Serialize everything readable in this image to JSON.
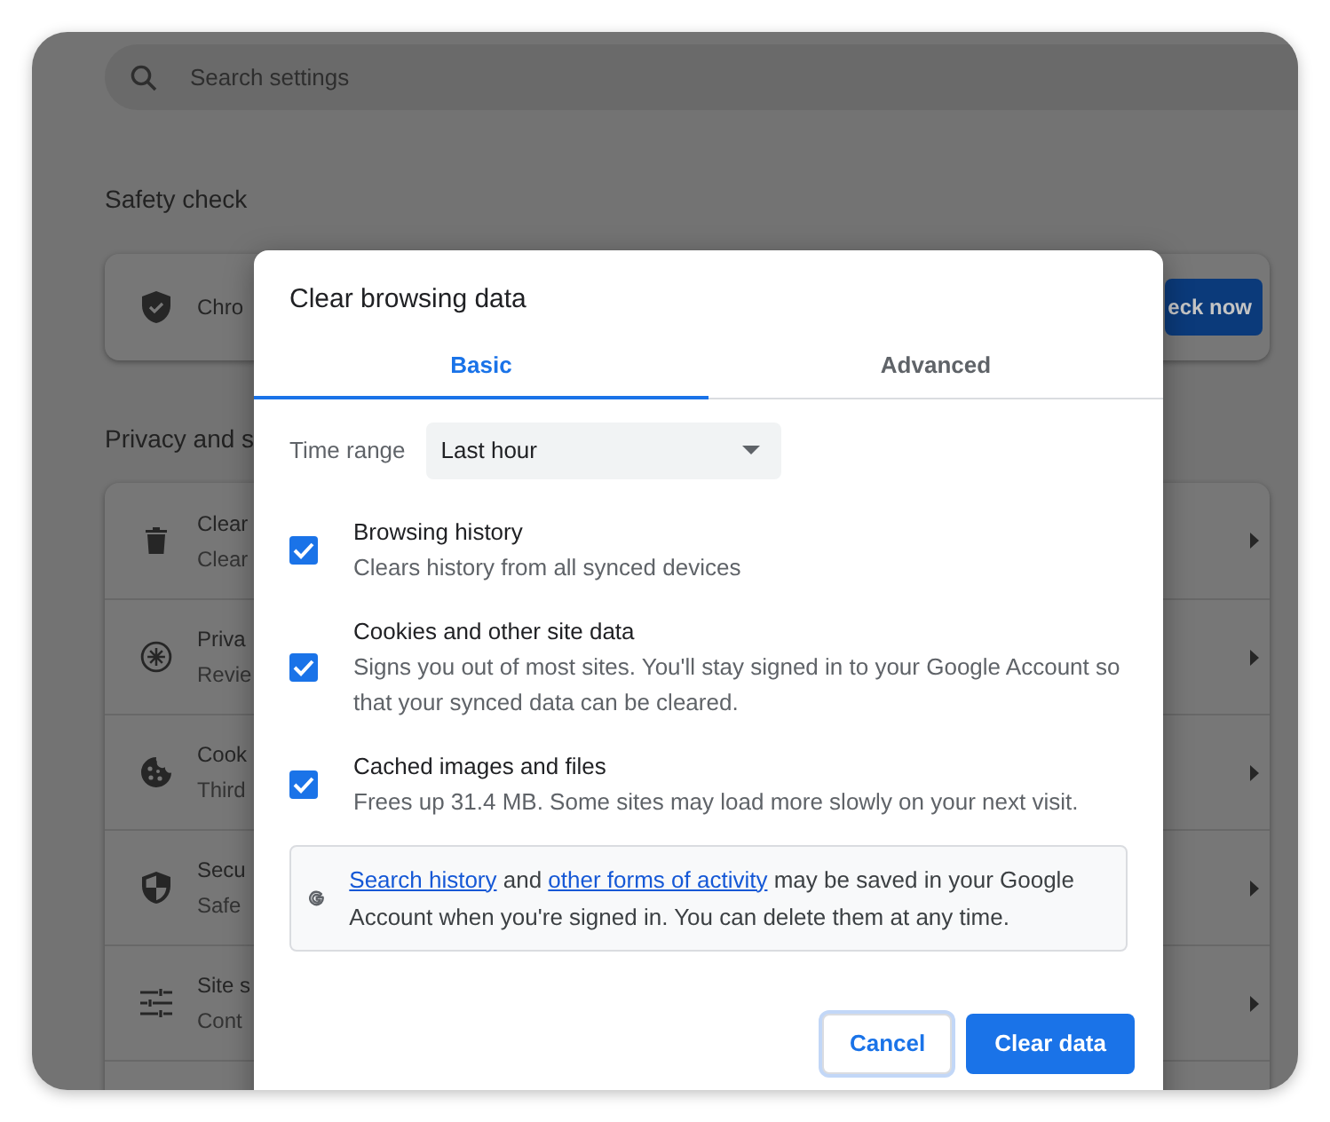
{
  "search": {
    "placeholder": "Search settings"
  },
  "safety_check": {
    "heading": "Safety check",
    "text": "Chro",
    "button": "eck now"
  },
  "privacy": {
    "heading": "Privacy and s",
    "rows": [
      {
        "kind": "trash",
        "title": "Clear",
        "subtitle": "Clear"
      },
      {
        "kind": "compass",
        "title": "Priva",
        "subtitle": "Revie"
      },
      {
        "kind": "cookie",
        "title": "Cook",
        "subtitle": "Third"
      },
      {
        "kind": "shield",
        "title": "Secu",
        "subtitle": "Safe"
      },
      {
        "kind": "sliders",
        "title": "Site s",
        "subtitle": "Cont"
      },
      {
        "kind": "blank",
        "title": "",
        "subtitle": ""
      }
    ]
  },
  "dialog": {
    "title": "Clear browsing data",
    "tabs": [
      {
        "label": "Basic",
        "selected": true
      },
      {
        "label": "Advanced",
        "selected": false
      }
    ],
    "time_range": {
      "label": "Time range",
      "value": "Last hour"
    },
    "options": [
      {
        "title": "Browsing history",
        "description": "Clears history from all synced devices",
        "checked": true
      },
      {
        "title": "Cookies and other site data",
        "description": "Signs you out of most sites. You'll stay signed in to your Google Account so that your synced data can be cleared.",
        "checked": true
      },
      {
        "title": "Cached images and files",
        "description": "Frees up 31.4 MB. Some sites may load more slowly on your next visit.",
        "checked": true
      }
    ],
    "notice": [
      {
        "kind": "link",
        "text": "Search history"
      },
      {
        "kind": "text",
        "text": " and "
      },
      {
        "kind": "link",
        "text": "other forms of activity"
      },
      {
        "kind": "text",
        "text": " may be saved in your Google Account when you're signed in. You can delete them at any time."
      }
    ],
    "buttons": [
      {
        "label": "Cancel",
        "kind": "secondary"
      },
      {
        "label": "Clear data",
        "kind": "primary"
      }
    ]
  }
}
